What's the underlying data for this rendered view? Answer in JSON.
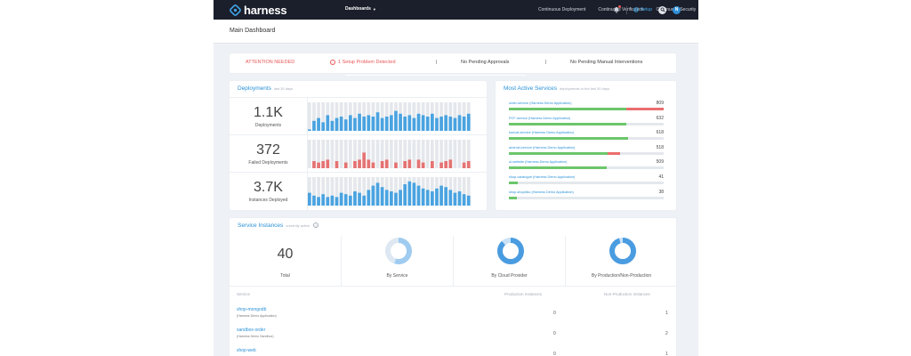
{
  "app": {
    "logo_text": "harness",
    "nav": [
      {
        "label": "Dashboards",
        "active": true,
        "has_caret": true
      },
      {
        "label": "Continuous Deployment",
        "active": false,
        "has_caret": false
      },
      {
        "label": "Continuous Verification",
        "active": false,
        "has_caret": false
      },
      {
        "label": "Continuous Security",
        "active": false,
        "has_caret": true
      }
    ],
    "setup_label": "Setup",
    "avatar_initial": "N",
    "page_title": "Main Dashboard"
  },
  "attention": {
    "label": "ATTENTION NEEDED",
    "problem_icon": "!",
    "problem_text": "1 Setup Problem Detected",
    "separator": "|",
    "approvals": "No Pending Approvals",
    "manual": "No Pending Manual Interventions"
  },
  "deployments": {
    "title": "Deployments",
    "subtitle": "last 30 days",
    "rows": [
      {
        "value": "1.1K",
        "label": "Deployments",
        "bar_color": "#4aa3e0",
        "bars": [
          0.05,
          0.35,
          0.45,
          0.3,
          0.55,
          0.35,
          0.45,
          0.5,
          0.4,
          0.55,
          0.45,
          0.6,
          0.5,
          0.55,
          0.5,
          0.65,
          0.45,
          0.5,
          0.55,
          0.7,
          0.6,
          0.5,
          0.55,
          0.45,
          0.6,
          0.55,
          0.5,
          0.6,
          0.45,
          0.5,
          0.55,
          0.5,
          0.45,
          0.55,
          0.5,
          0.6
        ]
      },
      {
        "value": "372",
        "label": "Failed Deployments",
        "bar_color": "#e57373",
        "bars": [
          0,
          0.25,
          0.2,
          0.25,
          0.3,
          0,
          0.25,
          0,
          0.2,
          0,
          0.25,
          0.3,
          0.55,
          0.3,
          0.2,
          0,
          0.25,
          0.3,
          0,
          0.2,
          0,
          0.25,
          0.3,
          0,
          0.3,
          0.2,
          0,
          0.25,
          0,
          0.2,
          0.25,
          0.3,
          0,
          0,
          0.2,
          0.25
        ]
      },
      {
        "value": "3.7K",
        "label": "Instances Deployed",
        "bar_color": "#4aa3e0",
        "bars": [
          0.45,
          0.35,
          0.3,
          0.4,
          0.3,
          0.35,
          0.3,
          0.45,
          0.4,
          0.35,
          0.5,
          0.45,
          0.35,
          0.55,
          0.7,
          0.8,
          0.65,
          0.55,
          0.5,
          0.45,
          0.55,
          0.75,
          0.85,
          0.8,
          0.7,
          0.6,
          0.55,
          0.5,
          0.6,
          0.7,
          0.65,
          0.55,
          0.45,
          0.5,
          0.4,
          0.35
        ]
      }
    ]
  },
  "active_services": {
    "title": "Most Active Services",
    "subtitle": "deployments in the last 30 days",
    "items": [
      {
        "name": "order-service (Harness Demo Application)",
        "count": "809",
        "success": 0.76,
        "failed": 0.24
      },
      {
        "name": "PCF-service (Harness Demo Application)",
        "count": "632",
        "success": 0.76,
        "failed": 0.0
      },
      {
        "name": "tomcat-service (Harness Demo Application)",
        "count": "618",
        "success": 0.77,
        "failed": 0.0
      },
      {
        "name": "android-service (Harness Demo Application)",
        "count": "518",
        "success": 0.64,
        "failed": 0.08
      },
      {
        "name": "ui-website (Harness Demo Application)",
        "count": "509",
        "success": 0.63,
        "failed": 0.0
      },
      {
        "name": "shop-catalogue (Harness Demo Application)",
        "count": "41",
        "success": 0.06,
        "failed": 0.0
      },
      {
        "name": "shop-shopdisc (Harness Demo Application)",
        "count": "38",
        "success": 0.05,
        "failed": 0.0
      }
    ]
  },
  "service_instances": {
    "title": "Service Instances",
    "subtitle": "currently active",
    "help_icon": "?",
    "total_value": "40",
    "total_label": "Total",
    "donuts": [
      {
        "label": "By Service",
        "segments": [
          {
            "value": 0.55,
            "color": "#9fcbf0"
          },
          {
            "value": 0.45,
            "color": "#dde8f3"
          }
        ]
      },
      {
        "label": "By Cloud Provider",
        "segments": [
          {
            "value": 0.88,
            "color": "#4a9ce0"
          },
          {
            "value": 0.12,
            "color": "#c9e1f6"
          }
        ]
      },
      {
        "label": "By Production/Non-Production",
        "segments": [
          {
            "value": 0.95,
            "color": "#4a9ce0"
          },
          {
            "value": 0.05,
            "color": "#c9e1f6"
          }
        ]
      }
    ],
    "columns": {
      "service": "Service",
      "prod": "Production Instances",
      "nonprod": "Non-Production Instances"
    },
    "rows": [
      {
        "name": "shop-mongodb",
        "app": "(Harness Demo Application)",
        "prod": "0",
        "nonprod": "1"
      },
      {
        "name": "sandbox-order",
        "app": "(Harness Demo Sandbox)",
        "prod": "0",
        "nonprod": "2"
      },
      {
        "name": "shop-web",
        "app": "",
        "prod": "0",
        "nonprod": "1"
      }
    ]
  }
}
